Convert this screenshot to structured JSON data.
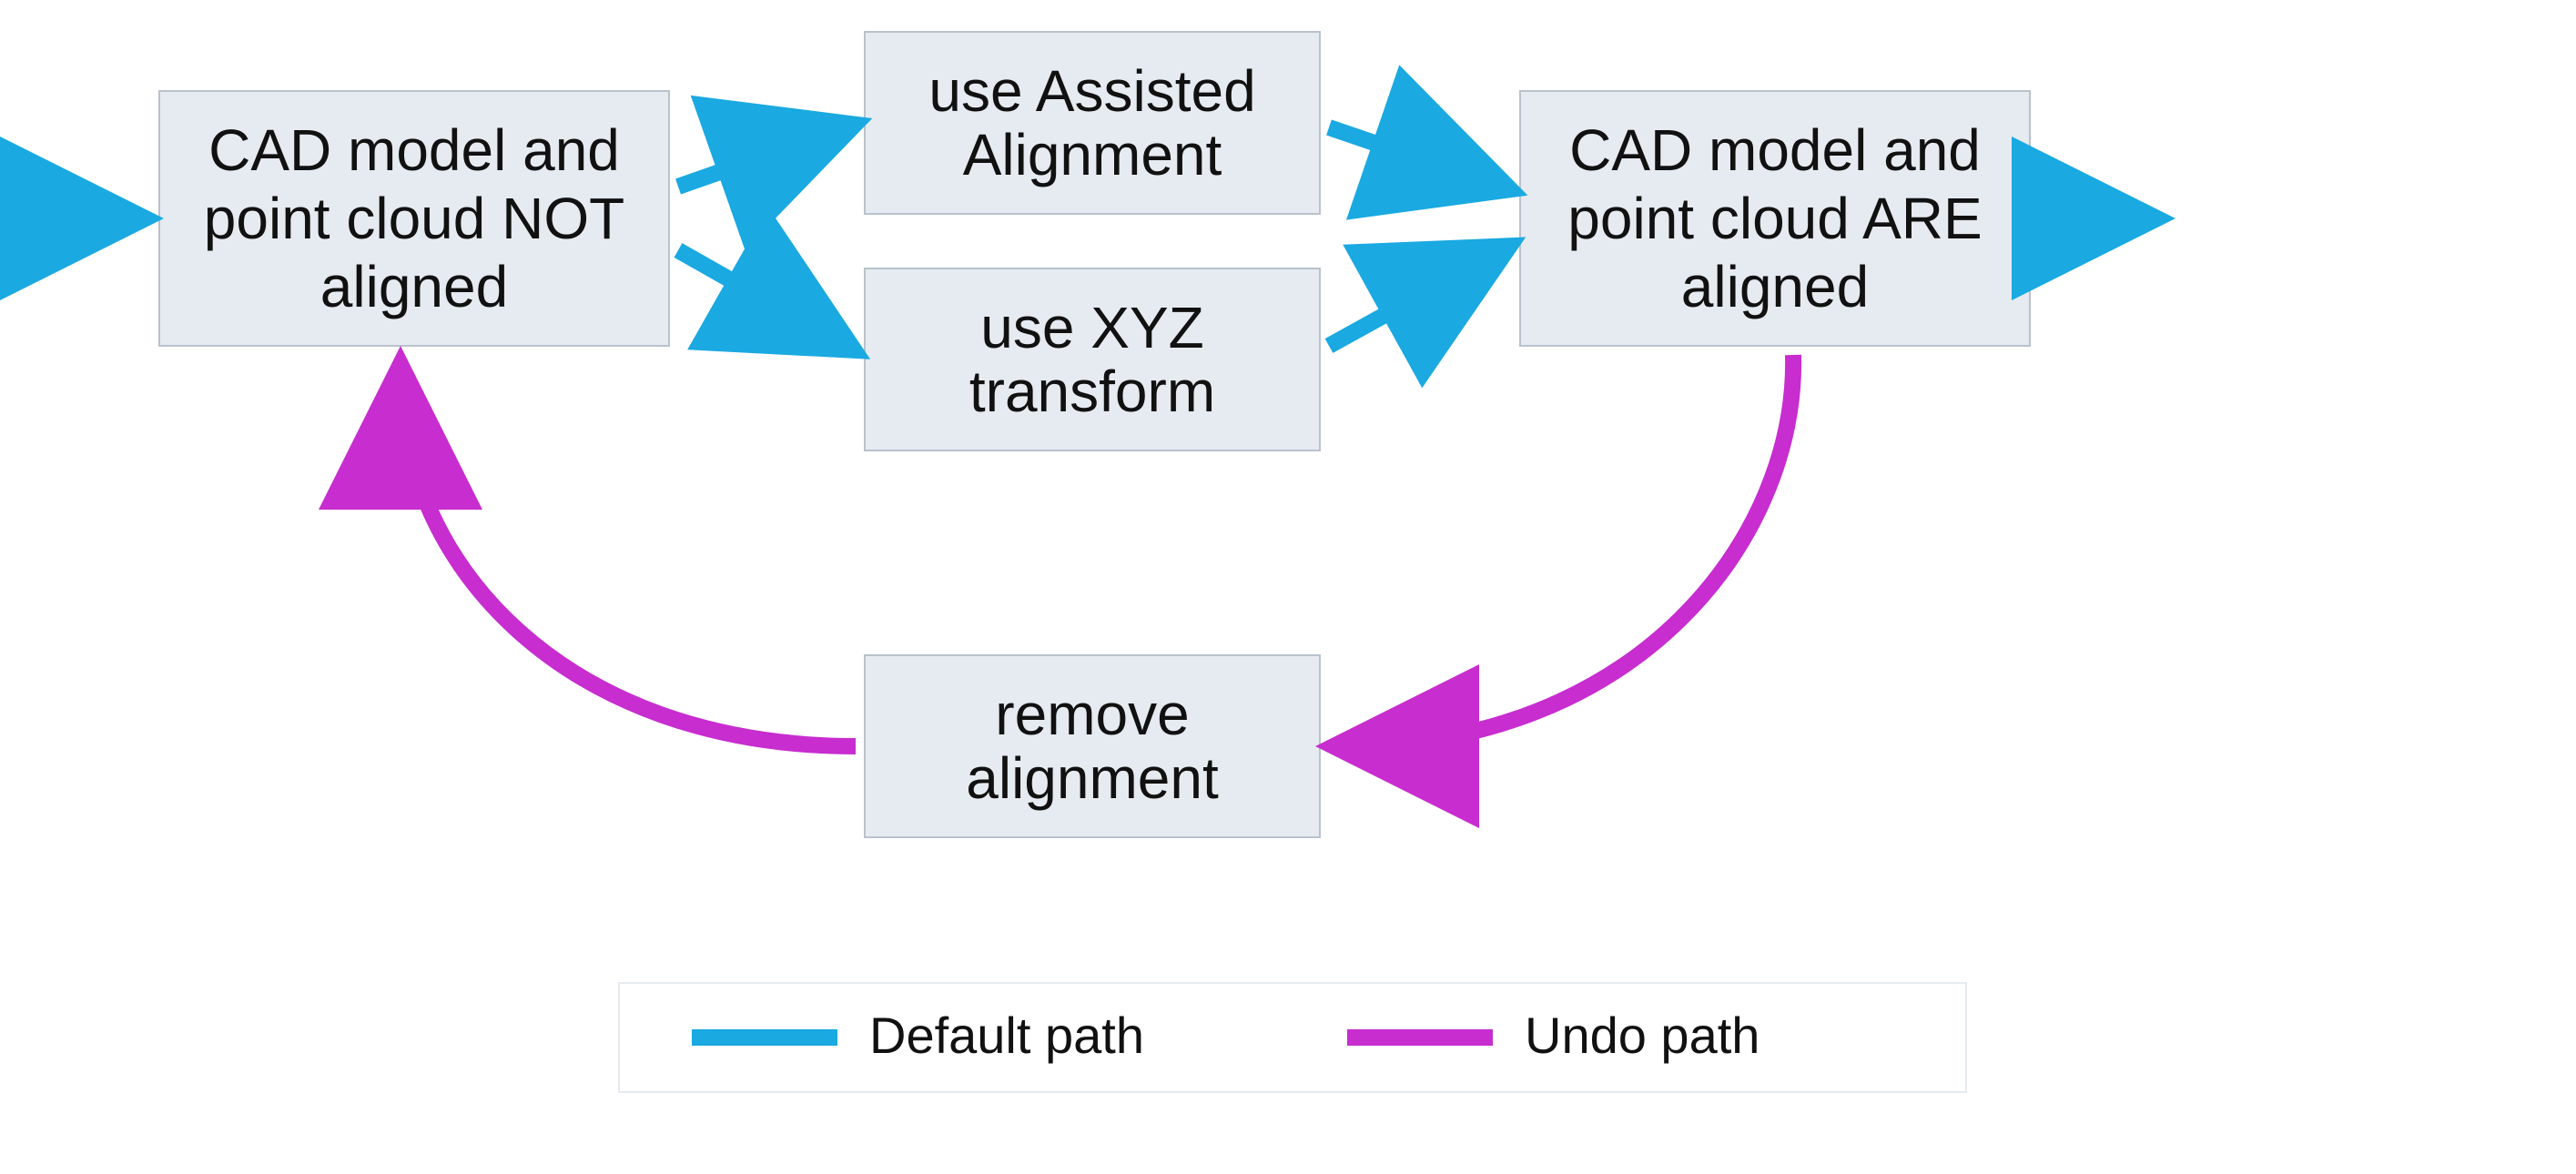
{
  "colors": {
    "default_path": "#1aa9e1",
    "undo_path": "#c72dcf",
    "node_fill": "#e5ebf0",
    "node_stroke": "#b9c2cc"
  },
  "nodes": {
    "not_aligned": {
      "lines": [
        "CAD model and",
        "point cloud NOT",
        "aligned"
      ]
    },
    "assisted": {
      "lines": [
        "use Assisted",
        "Alignment"
      ]
    },
    "xyz": {
      "lines": [
        "use XYZ",
        "transform"
      ]
    },
    "are_aligned": {
      "lines": [
        "CAD model and",
        "point cloud ARE",
        "aligned"
      ]
    },
    "remove": {
      "lines": [
        "remove",
        "alignment"
      ]
    }
  },
  "legend": {
    "default_label": "Default path",
    "undo_label": "Undo path"
  }
}
